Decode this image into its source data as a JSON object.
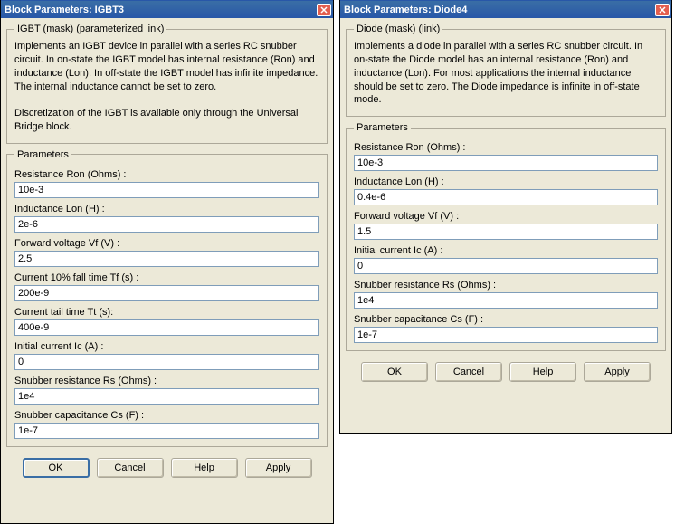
{
  "dialogLeft": {
    "title": "Block Parameters: IGBT3",
    "maskLegend": "IGBT (mask) (parameterized link)",
    "description": "Implements an IGBT device  in parallel with a series RC snubber circuit. In on-state the IGBT model has internal resistance (Ron) and inductance (Lon). In off-state the IGBT model has infinite impedance. The internal inductance cannot be set to zero.\n\nDiscretization of the IGBT is available only through the Universal Bridge block.",
    "paramsLegend": "Parameters",
    "params": {
      "ron_label": "Resistance Ron (Ohms) :",
      "ron_value": "10e-3",
      "lon_label": "Inductance Lon (H) :",
      "lon_value": "2e-6",
      "vf_label": "Forward voltage Vf (V) :",
      "vf_value": "2.5",
      "tf_label": "Current 10% fall time Tf (s) :",
      "tf_value": "200e-9",
      "tt_label": "Current tail time Tt (s):",
      "tt_value": "400e-9",
      "ic_label": "Initial current Ic (A) :",
      "ic_value": "0",
      "rs_label": "Snubber resistance Rs (Ohms) :",
      "rs_value": "1e4",
      "cs_label": "Snubber capacitance Cs (F) :",
      "cs_value": "1e-7"
    },
    "buttons": {
      "ok": "OK",
      "cancel": "Cancel",
      "help": "Help",
      "apply": "Apply"
    }
  },
  "dialogRight": {
    "title": "Block Parameters: Diode4",
    "maskLegend": "Diode (mask) (link)",
    "description": "Implements a diode in parallel with a series RC snubber circuit. In on-state the Diode model has an internal resistance (Ron) and inductance (Lon). For most applications the internal inductance should be set to zero. The Diode impedance is infinite in off-state mode.",
    "paramsLegend": "Parameters",
    "params": {
      "ron_label": "Resistance Ron (Ohms) :",
      "ron_value": "10e-3",
      "lon_label": "Inductance Lon (H) :",
      "lon_value": "0.4e-6",
      "vf_label": "Forward voltage Vf (V) :",
      "vf_value": "1.5",
      "ic_label": "Initial current Ic (A) :",
      "ic_value": "0",
      "rs_label": "Snubber resistance Rs (Ohms) :",
      "rs_value": "1e4",
      "cs_label": "Snubber capacitance Cs (F) :",
      "cs_value": "1e-7"
    },
    "buttons": {
      "ok": "OK",
      "cancel": "Cancel",
      "help": "Help",
      "apply": "Apply"
    }
  }
}
